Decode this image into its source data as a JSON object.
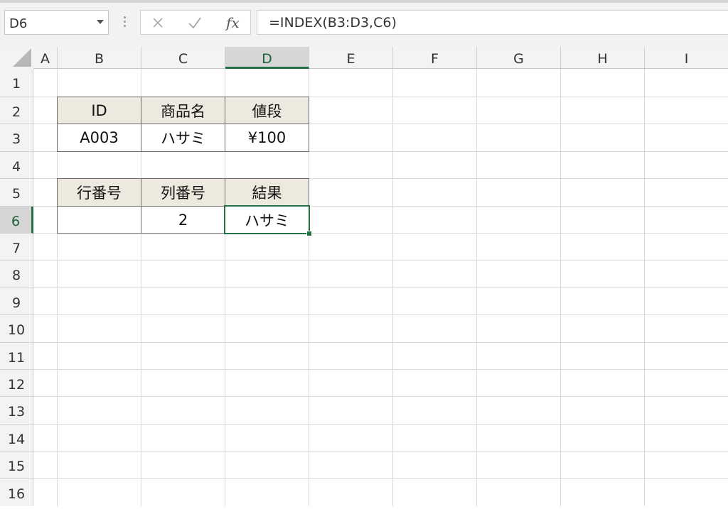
{
  "name_box": {
    "value": "D6"
  },
  "formula_bar": {
    "formula": "=INDEX(B3:D3,C6)",
    "fx_label": "fx",
    "cancel_icon": "close-icon",
    "enter_icon": "check-icon"
  },
  "columns": [
    "A",
    "B",
    "C",
    "D",
    "E",
    "F",
    "G",
    "H",
    "I"
  ],
  "rows": [
    "1",
    "2",
    "3",
    "4",
    "5",
    "6",
    "7",
    "8",
    "9",
    "10",
    "11",
    "12",
    "13",
    "14",
    "15",
    "16"
  ],
  "active_cell": {
    "column": "D",
    "row": "6"
  },
  "cells": {
    "B2": "ID",
    "C2": "商品名",
    "D2": "値段",
    "B3": "A003",
    "C3": "ハサミ",
    "D3": "¥100",
    "B5": "行番号",
    "C5": "列番号",
    "D5": "結果",
    "B6": "",
    "C6": "2",
    "D6": "ハサミ"
  },
  "colors": {
    "header_fill": "#ede9de",
    "selection": "#217346",
    "border": "#6d6d6d"
  }
}
